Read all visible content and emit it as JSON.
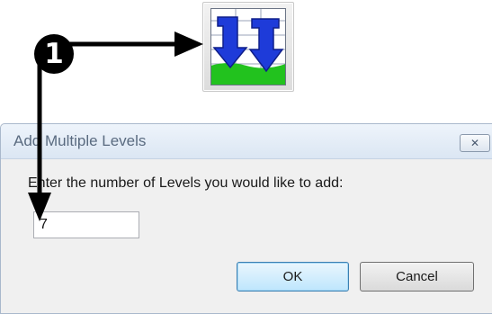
{
  "toolbar_icon": {
    "name": "add-multiple-levels-icon"
  },
  "callout": {
    "number": "1"
  },
  "dialog": {
    "title": "Add Multiple Levels",
    "close_glyph": "✕",
    "prompt": "Enter the number of Levels you would like to add:",
    "levels_value": "7",
    "ok_label": "OK",
    "cancel_label": "Cancel"
  },
  "colors": {
    "icon_arrow": "#1e3bd9",
    "icon_grass": "#22c21e",
    "callout": "#000000"
  }
}
